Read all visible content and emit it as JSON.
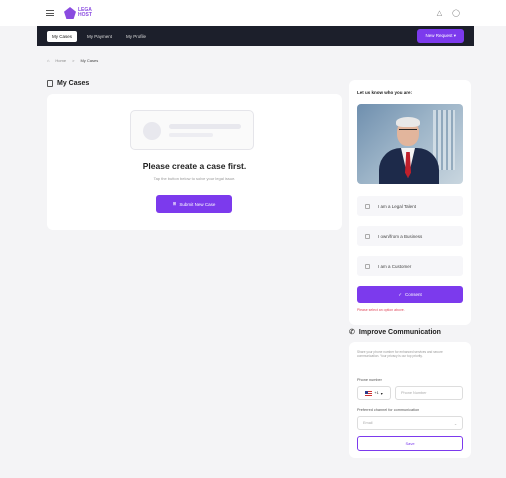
{
  "app": {
    "logo_text": "LEGA\nHOST"
  },
  "header": {
    "icons": [
      "bell-icon",
      "user-icon"
    ]
  },
  "nav": {
    "tabs": [
      {
        "label": "My Cases",
        "active": true
      },
      {
        "label": "My Payment",
        "active": false
      },
      {
        "label": "My Profile",
        "active": false
      }
    ],
    "new_request_label": "New Request"
  },
  "breadcrumb": {
    "home": "Home",
    "separator": ">",
    "current": "My Cases"
  },
  "cases": {
    "title": "My Cases",
    "empty_title": "Please create a case first.",
    "empty_subtitle": "Tap the button below to solve your legal issue.",
    "submit_label": "Submit New Case"
  },
  "who": {
    "title": "Let us know who you are:",
    "options": [
      "I am a Legal Talent",
      "I own/from a Business",
      "I am a Customer"
    ],
    "consent_label": "Consent",
    "error": "Please select an option above."
  },
  "comm": {
    "title": "Improve Communication",
    "description": "Share your phone number for enhanced services and secure communication. Your privacy is our top priority.",
    "phone_label": "Phone number",
    "country_code": "+1",
    "phone_placeholder": "Phone Number",
    "channel_label": "Preferred channel for communication",
    "channel_value": "Email",
    "save_label": "Save"
  },
  "colors": {
    "accent": "#7c3aed",
    "navbar": "#1c1f2b",
    "error": "#e0465a"
  }
}
